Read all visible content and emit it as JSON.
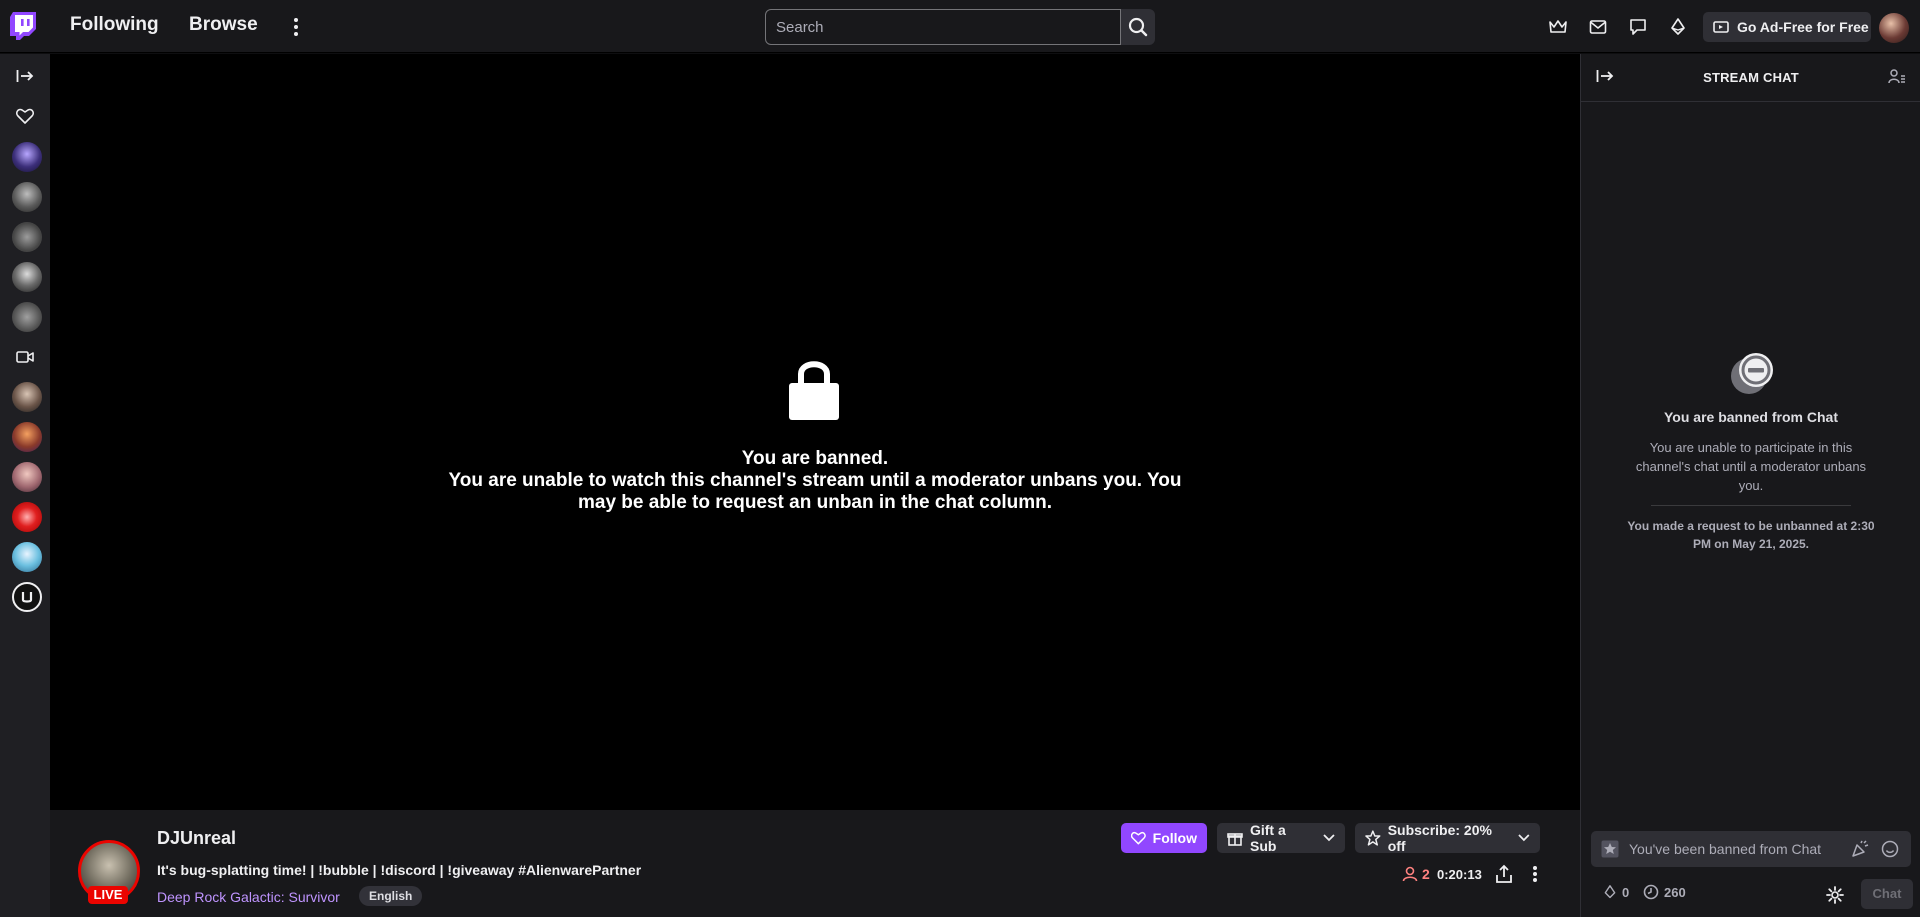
{
  "nav": {
    "following": "Following",
    "browse": "Browse",
    "search_placeholder": "Search",
    "ad_free": "Go Ad-Free for Free"
  },
  "player": {
    "ban_title": "You are banned.",
    "ban_message": "You are unable to watch this channel's stream until a moderator unbans you. You may be able to request an unban in the chat column."
  },
  "channel": {
    "name": "DJUnreal",
    "live": "LIVE",
    "title": "It's bug-splatting time! | !bubble | !discord | !giveaway #AlienwarePartner",
    "game": "Deep Rock Galactic: Survivor",
    "language": "English",
    "follow_label": "Follow",
    "gift_label": "Gift a Sub",
    "subscribe_label": "Subscribe: 20% off",
    "viewers": "2",
    "uptime": "0:20:13"
  },
  "chat": {
    "title": "STREAM CHAT",
    "banned_title": "You are banned from Chat",
    "banned_message": "You are unable to participate in this channel's chat until a moderator unbans you.",
    "request_message": "You made a request to be unbanned at 2:30 PM on May 21, 2025.",
    "input_placeholder": "You've been banned from Chat",
    "bits_count": "0",
    "points_count": "260",
    "chat_button": "Chat"
  },
  "colors": {
    "accent": "#9147ff",
    "live": "#eb0400",
    "game_link": "#bf94ff"
  }
}
